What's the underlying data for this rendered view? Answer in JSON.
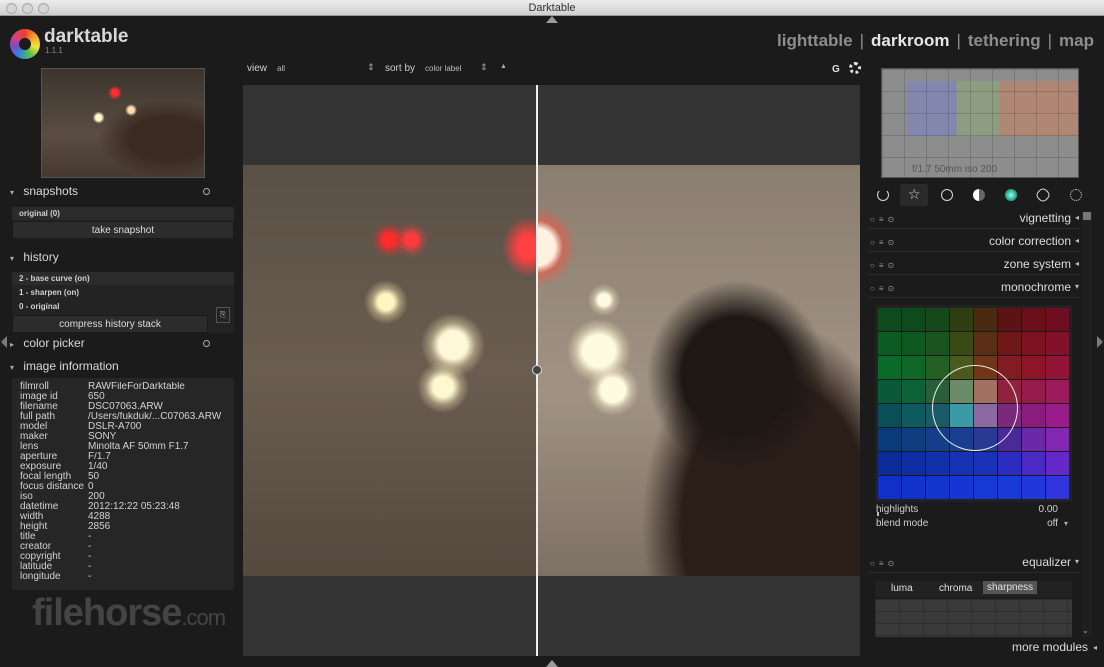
{
  "window": {
    "title": "Darktable"
  },
  "app": {
    "name": "darktable",
    "version": "1.1.1"
  },
  "views": [
    {
      "label": "lighttable",
      "active": false
    },
    {
      "label": "darkroom",
      "active": true
    },
    {
      "label": "tethering",
      "active": false
    },
    {
      "label": "map",
      "active": false
    }
  ],
  "views_separator": "|",
  "topbar": {
    "view_label": "view",
    "view_value": "all",
    "sort_label": "sort by",
    "sort_value": "color label",
    "sort_dir_icon": "▲",
    "spin_icon": "⇕",
    "grouping_label": "G"
  },
  "snapshots": {
    "title": "snapshots",
    "items": [
      "original (0)"
    ],
    "button": "take snapshot"
  },
  "history": {
    "title": "history",
    "items": [
      "2 - base curve (on)",
      "1 - sharpen (on)",
      "0 - original"
    ],
    "button": "compress history stack"
  },
  "color_picker": {
    "title": "color picker"
  },
  "image_information": {
    "title": "image information",
    "rows": [
      {
        "k": "filmroll",
        "v": "RAWFileForDarktable"
      },
      {
        "k": "image id",
        "v": "650"
      },
      {
        "k": "filename",
        "v": "DSC07063.ARW"
      },
      {
        "k": "full path",
        "v": "/Users/fukduk/...C07063.ARW"
      },
      {
        "k": "model",
        "v": "DSLR-A700"
      },
      {
        "k": "maker",
        "v": "SONY"
      },
      {
        "k": "lens",
        "v": "Minolta AF 50mm F1.7"
      },
      {
        "k": "aperture",
        "v": "F/1.7"
      },
      {
        "k": "exposure",
        "v": "1/40"
      },
      {
        "k": "focal length",
        "v": "50"
      },
      {
        "k": "focus distance",
        "v": "0"
      },
      {
        "k": "iso",
        "v": "200"
      },
      {
        "k": "datetime",
        "v": "2012:12:22 05:23:48"
      },
      {
        "k": "width",
        "v": "4288"
      },
      {
        "k": "height",
        "v": "2856"
      },
      {
        "k": "title",
        "v": "-"
      },
      {
        "k": "creator",
        "v": "-"
      },
      {
        "k": "copyright",
        "v": "-"
      },
      {
        "k": "latitude",
        "v": "-"
      },
      {
        "k": "longitude",
        "v": "-"
      }
    ]
  },
  "watermark": {
    "text": "filehorse",
    "suffix": ".com"
  },
  "histogram": {
    "text": "f/1.7 50mm iso 200"
  },
  "module_groups": [
    "power-icon",
    "star-icon",
    "circle-icon",
    "half-circle-icon",
    "color-icon",
    "correct-icon",
    "effect-icon"
  ],
  "modules": [
    {
      "name": "vignetting",
      "expanded": false
    },
    {
      "name": "color correction",
      "expanded": false
    },
    {
      "name": "zone system",
      "expanded": false
    },
    {
      "name": "monochrome",
      "expanded": true
    },
    {
      "name": "equalizer",
      "expanded": true
    }
  ],
  "monochrome": {
    "highlights_label": "highlights",
    "highlights_value": "0.00",
    "blend_label": "blend mode",
    "blend_value": "off"
  },
  "equalizer": {
    "tabs": [
      "luma",
      "chroma",
      "sharpness"
    ],
    "active_tab": "sharpness"
  },
  "more_modules": "more modules",
  "collapse_icon": "◂",
  "expand_icon": "▾",
  "colors": {
    "accent_text": "#e6e6e6",
    "inactive_view": "#8d8d8d",
    "panel_bg": "#1b1b1b"
  }
}
